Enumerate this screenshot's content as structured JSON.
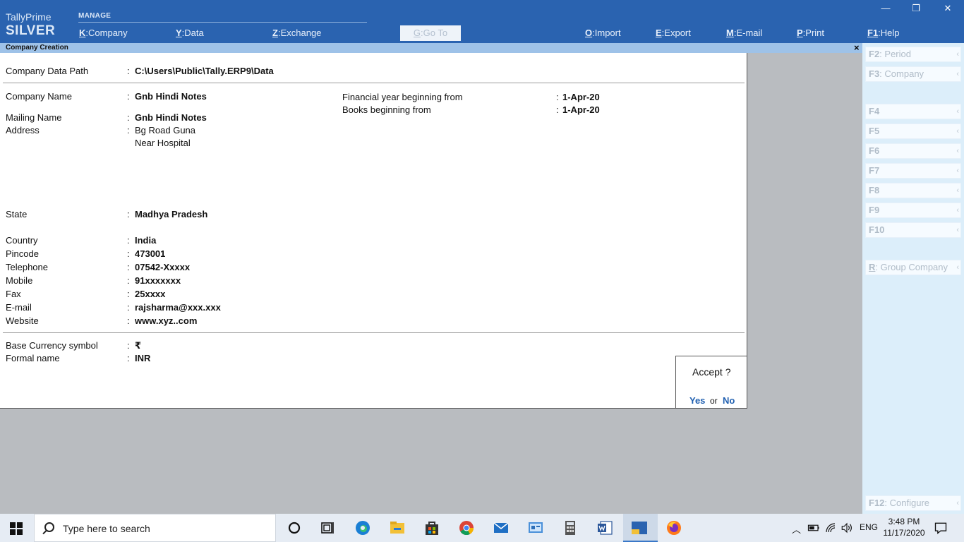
{
  "header": {
    "brand_top": "TallyPrime",
    "brand_bottom": "SILVER",
    "section": "MANAGE",
    "menu": [
      {
        "key": "K",
        "label": "Company"
      },
      {
        "key": "Y",
        "label": "Data"
      },
      {
        "key": "Z",
        "label": "Exchange"
      }
    ],
    "goto": {
      "key": "G",
      "label": "Go To"
    },
    "actions": [
      {
        "key": "O",
        "label": "Import"
      },
      {
        "key": "E",
        "label": "Export"
      },
      {
        "key": "M",
        "label": "E-mail"
      },
      {
        "key": "P",
        "label": "Print"
      },
      {
        "key": "F1",
        "label": "Help"
      }
    ],
    "window_controls": {
      "minimize": "—",
      "restore": "❐",
      "close": "✕"
    }
  },
  "screen": {
    "title": "Company  Creation",
    "close": "×"
  },
  "form": {
    "data_path": {
      "label": "Company Data Path",
      "value": "C:\\Users\\Public\\Tally.ERP9\\Data"
    },
    "company_name": {
      "label": "Company Name",
      "value": "Gnb Hindi Notes"
    },
    "mailing_name": {
      "label": "Mailing Name",
      "value": "Gnb Hindi Notes"
    },
    "address": {
      "label": "Address",
      "lines": [
        "Bg Road Guna",
        "Near Hospital"
      ]
    },
    "state": {
      "label": "State",
      "value": "Madhya Pradesh"
    },
    "country": {
      "label": "Country",
      "value": "India"
    },
    "pincode": {
      "label": "Pincode",
      "value": "473001"
    },
    "telephone": {
      "label": "Telephone",
      "value": "07542-Xxxxx"
    },
    "mobile": {
      "label": "Mobile",
      "value": "91xxxxxxx"
    },
    "fax": {
      "label": "Fax",
      "value": "25xxxx"
    },
    "email": {
      "label": "E-mail",
      "value": "rajsharma@xxx.xxx"
    },
    "website": {
      "label": "Website",
      "value": "www.xyz..com"
    },
    "currency_symbol": {
      "label": "Base Currency symbol",
      "value": "₹"
    },
    "formal_name": {
      "label": "Formal name",
      "value": "INR"
    },
    "fy_begin": {
      "label": "Financial year beginning from",
      "value": "1-Apr-20"
    },
    "books_begin": {
      "label": "Books beginning from",
      "value": "1-Apr-20"
    },
    "colon": ":"
  },
  "accept_dialog": {
    "question": "Accept ?",
    "yes": "Yes",
    "or": "or",
    "no": "No"
  },
  "right_buttons": [
    {
      "key": "F2",
      "label": "Period"
    },
    {
      "key": "F3",
      "label": "Company"
    },
    {
      "key": "F4",
      "label": ""
    },
    {
      "key": "F5",
      "label": ""
    },
    {
      "key": "F6",
      "label": ""
    },
    {
      "key": "F7",
      "label": ""
    },
    {
      "key": "F8",
      "label": ""
    },
    {
      "key": "F9",
      "label": ""
    },
    {
      "key": "F10",
      "label": ""
    },
    {
      "key": "R",
      "label": "Group Company"
    },
    {
      "key": "F12",
      "label": "Configure"
    }
  ],
  "chevron": "‹",
  "taskbar": {
    "search_placeholder": "Type here to search",
    "language": "ENG",
    "time": "3:48 PM",
    "date": "11/17/2020",
    "apps": [
      "cortana-icon",
      "task-view-icon",
      "edge-icon",
      "file-explorer-icon",
      "store-icon",
      "chrome-icon",
      "mail-icon",
      "control-panel-icon",
      "calculator-icon",
      "word-icon",
      "tally-icon",
      "firefox-icon"
    ]
  }
}
